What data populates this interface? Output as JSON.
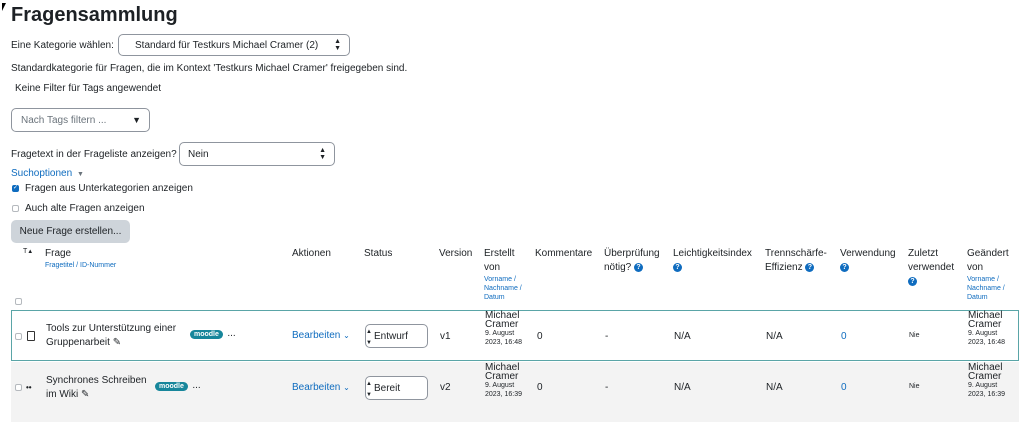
{
  "page_title": "Fragensammlung",
  "category": {
    "label": "Eine Kategorie wählen:",
    "selected": "Standard für Testkurs Michael Cramer (2)",
    "description": "Standardkategorie für Fragen, die im Kontext 'Testkurs Michael Cramer' freigegeben sind."
  },
  "tags": {
    "no_filter_text": "Keine Filter für Tags angewendet",
    "filter_placeholder": "Nach Tags filtern ..."
  },
  "question_text": {
    "label": "Fragetext in der Frageliste anzeigen?",
    "selected": "Nein"
  },
  "search_options": {
    "label": "Suchoptionen",
    "subcategories_label": "Fragen aus Unterkategorien anzeigen",
    "subcategories_checked": true,
    "old_questions_label": "Auch alte Fragen anzeigen",
    "old_questions_checked": false
  },
  "new_question_button": "Neue Frage erstellen...",
  "table": {
    "headers": {
      "sort_t": "T",
      "question": "Frage",
      "question_sub": "Fragetitel / ID-Nummer",
      "actions": "Aktionen",
      "status": "Status",
      "version": "Version",
      "created_by": "Erstellt von",
      "created_sub": "Vorname / Nachname / Datum",
      "comments": "Kommentare",
      "review": "Überprüfung nötig?",
      "facility": "Leichtigkeitsindex",
      "discrimination": "Trennschärfe-Effizienz",
      "usage": "Verwendung",
      "last_used": "Zuletzt verwendet",
      "modified_by": "Geändert von",
      "modified_sub": "Vorname / Nachname / Datum"
    },
    "rows": [
      {
        "title_line1": "Tools zur Unterstützung einer",
        "title_line2": "Gruppenarbeit",
        "badge": "moodle",
        "more": "...",
        "action": "Bearbeiten",
        "status": "Entwurf",
        "version": "v1",
        "creator_first": "Michael",
        "creator_last": "Cramer",
        "created_date": "9. August 2023, 16:48",
        "comments": "0",
        "review": "-",
        "facility": "N/A",
        "discrimination": "N/A",
        "usage": "0",
        "last_used": "Nie",
        "modifier_first": "Michael",
        "modifier_last": "Cramer",
        "modified_date": "9. August 2023, 16:48"
      },
      {
        "title_line1": "Synchrones Schreiben",
        "title_line2": "im Wiki",
        "badge": "moodle",
        "more": "...",
        "action": "Bearbeiten",
        "status": "Bereit",
        "version": "v2",
        "creator_first": "Michael",
        "creator_last": "Cramer",
        "created_date": "9. August 2023, 16:39",
        "comments": "0",
        "review": "-",
        "facility": "N/A",
        "discrimination": "N/A",
        "usage": "0",
        "last_used": "Nie",
        "modifier_first": "Michael",
        "modifier_last": "Cramer",
        "modified_date": "9. August 2023, 16:39"
      }
    ]
  },
  "colors": {
    "primary": "#0f6cbf",
    "badge": "#17869b",
    "row_highlight_border": "#5aa5a7"
  }
}
